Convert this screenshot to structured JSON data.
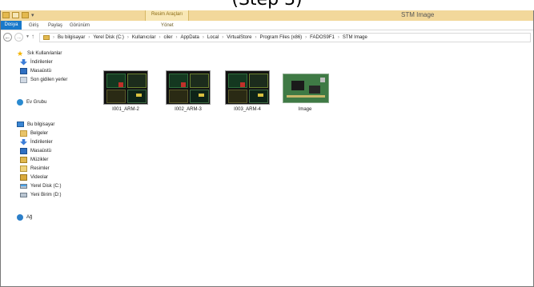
{
  "caption": "(Step 3)",
  "window": {
    "title": "STM Image",
    "contextual_tab_group": "Resim Araçları"
  },
  "ribbon": {
    "tabs": [
      {
        "label": "Dosya"
      },
      {
        "label": "Giriş"
      },
      {
        "label": "Paylaş"
      },
      {
        "label": "Görünüm"
      },
      {
        "label": "Yönet"
      }
    ]
  },
  "navigation": {
    "back": "←",
    "forward": "→",
    "up": "↑"
  },
  "address": {
    "crumbs": [
      "Bu bilgisayar",
      "Yerel Disk (C:)",
      "Kullanıcılar",
      "ciler",
      "AppData",
      "Local",
      "VirtualStore",
      "Program Files (x86)",
      "FADOS9F1",
      "STM Image"
    ],
    "separator": "›"
  },
  "sidebar": {
    "favorites": {
      "label": "Sık Kullanılanlar",
      "items": [
        {
          "label": "İndirilenler",
          "icon": "download-folder-icon"
        },
        {
          "label": "Masaüstü",
          "icon": "desktop-icon"
        },
        {
          "label": "Son gidilen yerler",
          "icon": "recent-places-icon"
        }
      ]
    },
    "homegroup": {
      "label": "Ev Grubu"
    },
    "computer": {
      "label": "Bu bilgisayar",
      "items": [
        {
          "label": "Belgeler",
          "icon": "documents-folder-icon"
        },
        {
          "label": "İndirilenler",
          "icon": "downloads-folder-icon"
        },
        {
          "label": "Masaüstü",
          "icon": "desktop-folder-icon"
        },
        {
          "label": "Müzikler",
          "icon": "music-folder-icon"
        },
        {
          "label": "Resimler",
          "icon": "pictures-folder-icon"
        },
        {
          "label": "Videolar",
          "icon": "videos-folder-icon"
        },
        {
          "label": "Yerel Disk (C:)",
          "icon": "os-disk-icon",
          "selected": true
        },
        {
          "label": "Yeni Birim (D:)",
          "icon": "disk-icon"
        }
      ]
    },
    "network": {
      "label": "Ağ"
    }
  },
  "files": [
    {
      "name": "I001_ARM-2",
      "type": "screenshot"
    },
    {
      "name": "I002_ARM-3",
      "type": "screenshot"
    },
    {
      "name": "I003_ARM-4",
      "type": "screenshot"
    },
    {
      "name": "Image",
      "type": "pcb-photo"
    }
  ]
}
